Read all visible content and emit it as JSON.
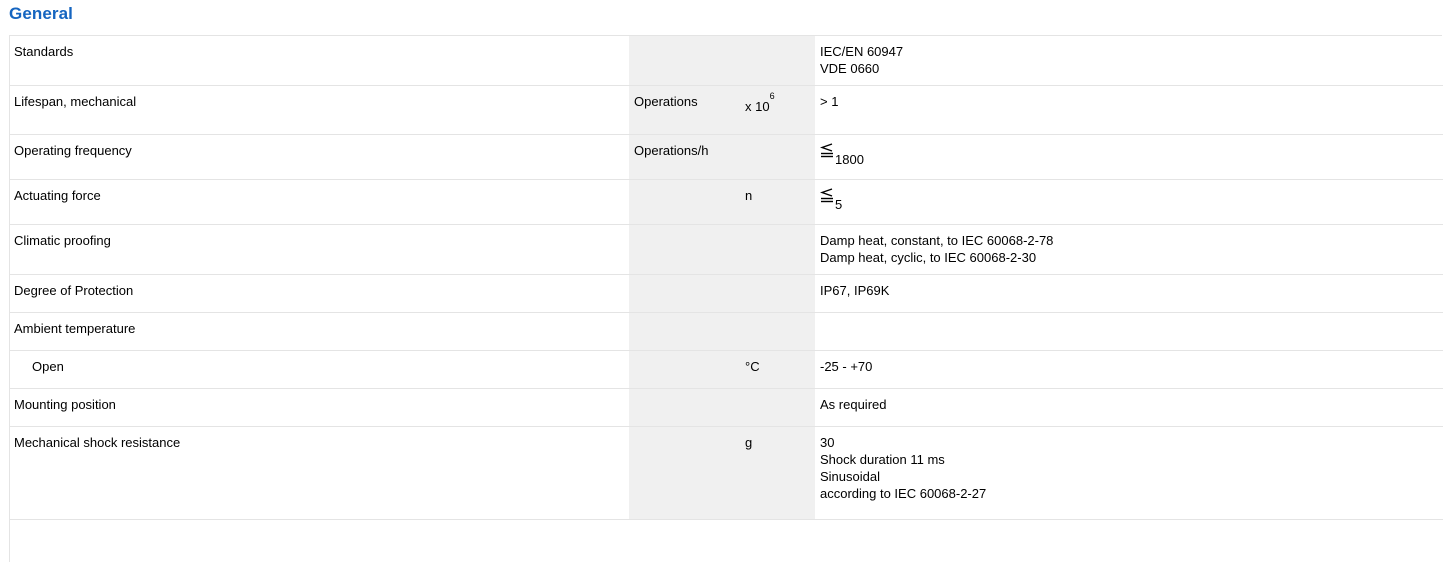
{
  "section": {
    "title": "General"
  },
  "rows": {
    "standards": {
      "label": "Standards",
      "unit": "",
      "multiplier": "",
      "values": [
        "IEC/EN 60947",
        "VDE 0660"
      ]
    },
    "lifespan": {
      "label": "Lifespan, mechanical",
      "unit": "Operations",
      "multiplier_base": "x 10",
      "multiplier_exp": "6",
      "value": "> 1"
    },
    "frequency": {
      "label": "Operating frequency",
      "unit": "Operations/h",
      "multiplier": "",
      "value_icon": "less-than-or-equal-icon",
      "value": "1800"
    },
    "force": {
      "label": "Actuating force",
      "unit": "",
      "multiplier": "n",
      "value_icon": "less-than-or-equal-icon",
      "value": "5"
    },
    "climatic": {
      "label": "Climatic proofing",
      "unit": "",
      "multiplier": "",
      "values": [
        "Damp heat, constant, to IEC 60068-2-78",
        "Damp heat, cyclic, to IEC 60068-2-30"
      ]
    },
    "protection": {
      "label": "Degree of Protection",
      "unit": "",
      "multiplier": "",
      "value": "IP67, IP69K"
    },
    "ambient": {
      "label": "Ambient temperature",
      "unit": "",
      "multiplier": "",
      "value": ""
    },
    "open": {
      "label": "Open",
      "unit": "",
      "multiplier": "°C",
      "value": "-25 - +70"
    },
    "mounting": {
      "label": "Mounting position",
      "unit": "",
      "multiplier": "",
      "value": "As required"
    },
    "shock": {
      "label": "Mechanical shock resistance",
      "unit": "",
      "multiplier": "g",
      "values": [
        "30",
        "Shock duration 11 ms",
        "Sinusoidal",
        "according to IEC 60068-2-27"
      ]
    }
  }
}
